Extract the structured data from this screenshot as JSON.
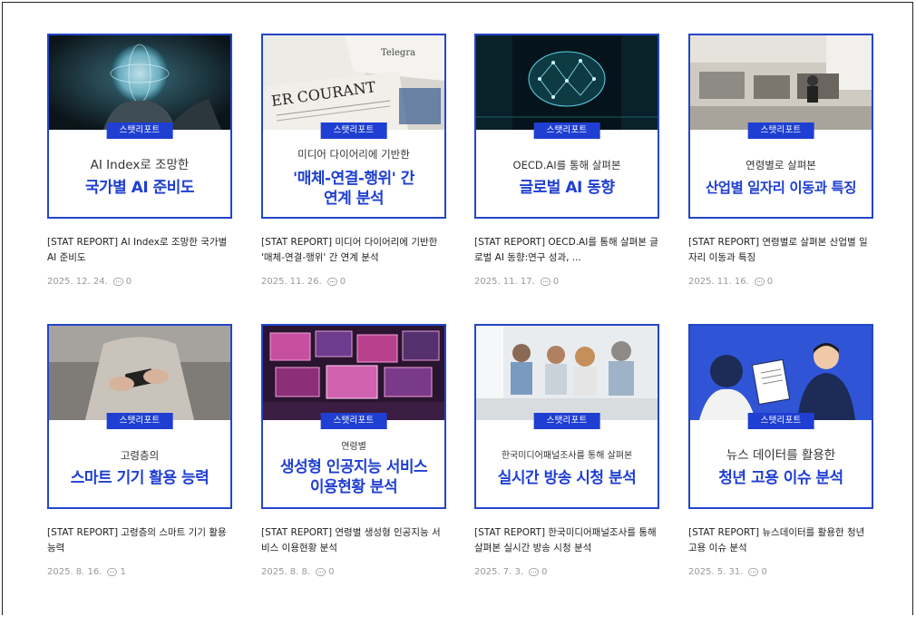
{
  "tag_label": "스탯리포트",
  "cards": [
    {
      "sub": "AI Index로 조망한",
      "hl1": "국가별 AI 준비도",
      "hl2": "",
      "caption": "[STAT REPORT] AI Index로 조망한 국가별 AI 준비도",
      "date": "2025. 12. 24.",
      "comments": "0"
    },
    {
      "sub": "미디어 다이어리에 기반한",
      "hl1": "'매체-연결-행위' 간",
      "hl2": "연계 분석",
      "caption": "[STAT REPORT] 미디어 다이어리에 기반한 '매체-연결-행위' 간 연계 분석",
      "date": "2025. 11. 26.",
      "comments": "0"
    },
    {
      "sub": "OECD.AI를 통해 살펴본",
      "hl1": "글로벌 AI 동향",
      "hl2": "",
      "caption": "[STAT REPORT] OECD.AI를 통해 살펴본 글로벌 AI 동향:연구 성과, ...",
      "date": "2025. 11. 17.",
      "comments": "0"
    },
    {
      "sub": "연령별로 살펴본",
      "hl1": "산업별 일자리 이동과 특징",
      "hl2": "",
      "caption": "[STAT REPORT] 연령별로 살펴본 산업별 일자리 이동과 특징",
      "date": "2025. 11. 16.",
      "comments": "0"
    },
    {
      "sub": "고령층의",
      "hl1": "스마트 기기 활용 능력",
      "hl2": "",
      "caption": "[STAT REPORT] 고령층의 스마트 기기 활용능력",
      "date": "2025. 8. 16.",
      "comments": "1"
    },
    {
      "sub": "연령별",
      "hl1": "생성형 인공지능 서비스",
      "hl2": "이용현황 분석",
      "caption": "[STAT REPORT] 연령별 생성형 인공지능 서비스 이용현황 분석",
      "date": "2025. 8. 8.",
      "comments": "0"
    },
    {
      "sub": "한국미디어패널조사를 통해 살펴본",
      "hl1": "실시간 방송 시청 분석",
      "hl2": "",
      "caption": "[STAT REPORT] 한국미디어패널조사를 통해 살펴본 실시간 방송 시청 분석",
      "date": "2025. 7. 3.",
      "comments": "0"
    },
    {
      "sub": "뉴스 데이터를 활용한",
      "hl1": "청년 고용 이슈 분석",
      "hl2": "",
      "caption": "[STAT REPORT] 뉴스데이터를 활용한 청년 고용 이슈 분석",
      "date": "2025. 5. 31.",
      "comments": "0"
    }
  ]
}
